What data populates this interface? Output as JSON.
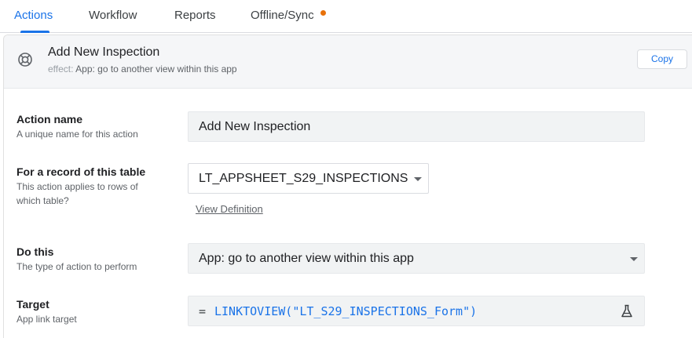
{
  "tabs": [
    {
      "label": "Actions",
      "active": true
    },
    {
      "label": "Workflow",
      "active": false
    },
    {
      "label": "Reports",
      "active": false
    },
    {
      "label": "Offline/Sync",
      "active": false,
      "badge_color": "#e8710a"
    }
  ],
  "header": {
    "icon": "lifebuoy-icon",
    "title": "Add New Inspection",
    "effect_label": "effect:",
    "effect_value": "App: go to another view within this app",
    "copy_label": "Copy"
  },
  "form": {
    "action_name": {
      "title": "Action name",
      "desc": "A unique name for this action",
      "value": "Add New Inspection"
    },
    "record_table": {
      "title": "For a record of this table",
      "desc": "This action applies to rows of which table?",
      "value": "LT_APPSHEET_S29_INSPECTIONS",
      "link": "View Definition"
    },
    "do_this": {
      "title": "Do this",
      "desc": "The type of action to perform",
      "value": "App: go to another view within this app"
    },
    "target": {
      "title": "Target",
      "desc": "App link target",
      "eq": "=",
      "value": "LINKTOVIEW(\"LT_S29_INSPECTIONS_Form\")",
      "icon": "flask-icon"
    }
  },
  "colors": {
    "accent": "#1a73e8",
    "badge": "#e8710a"
  }
}
